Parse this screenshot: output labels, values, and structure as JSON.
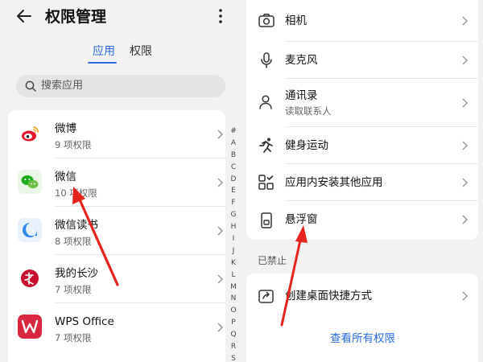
{
  "left": {
    "header": {
      "title": "权限管理",
      "back_icon": "arrow-left-icon",
      "more_icon": "more-vertical-icon"
    },
    "tabs": [
      {
        "label": "应用",
        "active": true
      },
      {
        "label": "权限",
        "active": false
      }
    ],
    "search": {
      "placeholder": "搜索应用",
      "icon": "search-icon"
    },
    "apps": [
      {
        "name": "微博",
        "count": "9 项权限",
        "icon": "weibo-icon",
        "color": "#e6162d"
      },
      {
        "name": "微信",
        "count": "10 项权限",
        "icon": "wechat-icon",
        "color": "#1aad19"
      },
      {
        "name": "微信读书",
        "count": "8 项权限",
        "icon": "weread-icon",
        "color": "#2b8cee"
      },
      {
        "name": "我的长沙",
        "count": "7 项权限",
        "icon": "mychangsha-icon",
        "color": "#c8102e"
      },
      {
        "name": "WPS Office",
        "count": "7 项权限",
        "icon": "wps-icon",
        "color": "#d7263d"
      }
    ],
    "alphabet": [
      "#",
      "A",
      "B",
      "C",
      "D",
      "E",
      "F",
      "G",
      "H",
      "I",
      "J",
      "K",
      "L",
      "M",
      "N",
      "O",
      "P",
      "Q",
      "R",
      "S"
    ]
  },
  "right": {
    "permissions": [
      {
        "label": "相机",
        "icon": "camera-icon"
      },
      {
        "label": "麦克风",
        "icon": "microphone-icon"
      },
      {
        "label": "通讯录",
        "sub": "读取联系人",
        "icon": "contacts-icon"
      },
      {
        "label": "健身运动",
        "icon": "running-icon"
      },
      {
        "label": "应用内安装其他应用",
        "icon": "apps-install-icon"
      },
      {
        "label": "悬浮窗",
        "icon": "floating-window-icon"
      }
    ],
    "blocked_section_label": "已禁止",
    "blocked": [
      {
        "label": "创建桌面快捷方式",
        "icon": "shortcut-icon"
      }
    ],
    "view_all": "查看所有权限"
  },
  "colors": {
    "accent": "#2a6be6",
    "annotation_arrow": "#e8231c"
  }
}
